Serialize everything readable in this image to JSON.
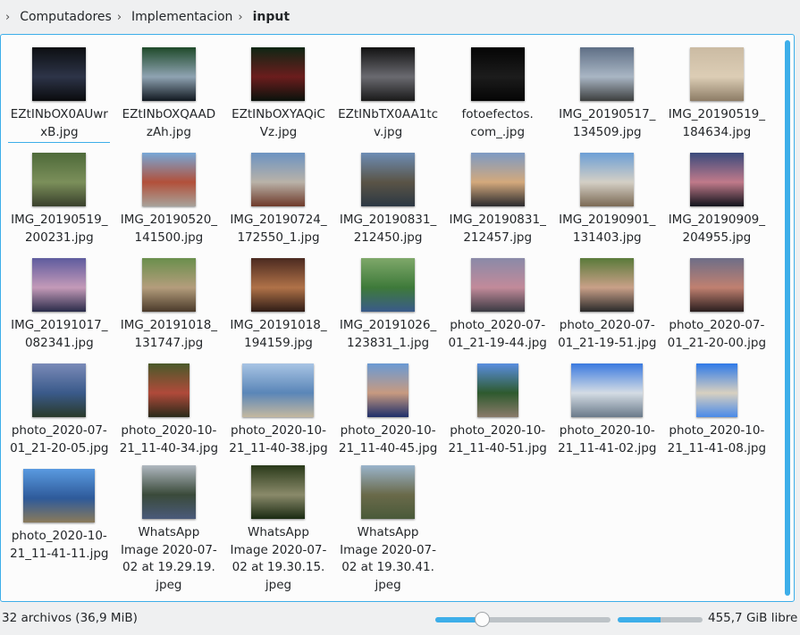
{
  "breadcrumb": {
    "items": [
      "Computadores",
      "Implementacion",
      "input"
    ]
  },
  "files": [
    {
      "name": "EZtINbOX0AUwr\nxB.jpg",
      "tw": 60,
      "th": 60,
      "colors": [
        "#0d0f12",
        "#2d3448",
        "#0a0b0d"
      ]
    },
    {
      "name": "EZtINbOXQAAD\nzAh.jpg",
      "tw": 60,
      "th": 60,
      "colors": [
        "#1f4a2a",
        "#8fa3b2",
        "#111820"
      ]
    },
    {
      "name": "EZtINbOXYAQiC\nVz.jpg",
      "tw": 60,
      "th": 60,
      "colors": [
        "#0f2614",
        "#6b1d1d",
        "#0a120c"
      ]
    },
    {
      "name": "EZtINbTX0AA1tc\nv.jpg",
      "tw": 60,
      "th": 60,
      "colors": [
        "#121212",
        "#6a6a70",
        "#1a1a1a"
      ]
    },
    {
      "name": "fotoefectos.\ncom_.jpg",
      "tw": 60,
      "th": 60,
      "colors": [
        "#050505",
        "#1c1c1c",
        "#050505"
      ]
    },
    {
      "name": "IMG_20190517_\n134509.jpg",
      "tw": 60,
      "th": 60,
      "colors": [
        "#5f6f86",
        "#a9b6c4",
        "#3d3f3f"
      ]
    },
    {
      "name": "IMG_20190519_\n184634.jpg",
      "tw": 60,
      "th": 60,
      "colors": [
        "#cbbba3",
        "#dccdb5",
        "#8d7c66"
      ]
    },
    {
      "name": "IMG_20190519_\n200231.jpg",
      "tw": 60,
      "th": 60,
      "colors": [
        "#4e6a3a",
        "#7b8f5a",
        "#39402c"
      ]
    },
    {
      "name": "IMG_20190520_\n141500.jpg",
      "tw": 60,
      "th": 60,
      "colors": [
        "#77a8d8",
        "#b2503a",
        "#a8a29a"
      ]
    },
    {
      "name": "IMG_20190724_\n172550_1.jpg",
      "tw": 60,
      "th": 60,
      "colors": [
        "#6c93c2",
        "#b9b2a8",
        "#6e3a2a"
      ]
    },
    {
      "name": "IMG_20190831_\n212450.jpg",
      "tw": 60,
      "th": 60,
      "colors": [
        "#6d8db5",
        "#5a5446",
        "#2c3844"
      ]
    },
    {
      "name": "IMG_20190831_\n212457.jpg",
      "tw": 60,
      "th": 60,
      "colors": [
        "#7d9ac4",
        "#d3a97c",
        "#2b2b2e"
      ]
    },
    {
      "name": "IMG_20190901_\n131403.jpg",
      "tw": 60,
      "th": 60,
      "colors": [
        "#6c9fd6",
        "#d4cfc5",
        "#7b6a55"
      ]
    },
    {
      "name": "IMG_20190909_\n204955.jpg",
      "tw": 60,
      "th": 60,
      "colors": [
        "#3a4a7c",
        "#c07a8a",
        "#12141c"
      ]
    },
    {
      "name": "IMG_20191017_\n082341.jpg",
      "tw": 60,
      "th": 60,
      "colors": [
        "#5e5b9e",
        "#c49ab8",
        "#2a2c4a"
      ]
    },
    {
      "name": "IMG_20191018_\n131747.jpg",
      "tw": 60,
      "th": 60,
      "colors": [
        "#6a8f4c",
        "#b49d7c",
        "#4a3a2a"
      ]
    },
    {
      "name": "IMG_20191018_\n194159.jpg",
      "tw": 60,
      "th": 60,
      "colors": [
        "#4b2a20",
        "#b07248",
        "#2f1c16"
      ]
    },
    {
      "name": "IMG_20191026_\n123831_1.jpg",
      "tw": 60,
      "th": 60,
      "colors": [
        "#7fa86a",
        "#3e7a3a",
        "#3a5a8a"
      ]
    },
    {
      "name": "photo_2020-07-\n01_21-19-44.jpg",
      "tw": 60,
      "th": 60,
      "colors": [
        "#8a8aa8",
        "#c28a9a",
        "#3a3a42"
      ]
    },
    {
      "name": "photo_2020-07-\n01_21-19-51.jpg",
      "tw": 60,
      "th": 60,
      "colors": [
        "#5a7a3a",
        "#c9a088",
        "#2a2a2a"
      ]
    },
    {
      "name": "photo_2020-07-\n01_21-20-00.jpg",
      "tw": 60,
      "th": 60,
      "colors": [
        "#6e6e88",
        "#c08070",
        "#2a1e1e"
      ]
    },
    {
      "name": "photo_2020-07-\n01_21-20-05.jpg",
      "tw": 60,
      "th": 60,
      "colors": [
        "#7a8ab8",
        "#3a5a8a",
        "#2a3a2a"
      ]
    },
    {
      "name": "photo_2020-10-\n21_11-40-34.jpg",
      "tw": 46,
      "th": 60,
      "colors": [
        "#4a5a2a",
        "#b04a3a",
        "#2a2a1a"
      ]
    },
    {
      "name": "photo_2020-10-\n21_11-40-38.jpg",
      "tw": 80,
      "th": 60,
      "colors": [
        "#a8c4e4",
        "#5a86b8",
        "#c4b8a0"
      ]
    },
    {
      "name": "photo_2020-10-\n21_11-40-45.jpg",
      "tw": 46,
      "th": 60,
      "colors": [
        "#6a9ad4",
        "#c79a80",
        "#1e2e6a"
      ]
    },
    {
      "name": "photo_2020-10-\n21_11-40-51.jpg",
      "tw": 46,
      "th": 60,
      "colors": [
        "#5a8ee0",
        "#2e5a2e",
        "#8a7a6a"
      ]
    },
    {
      "name": "photo_2020-10-\n21_11-41-02.jpg",
      "tw": 80,
      "th": 60,
      "colors": [
        "#3a7ae0",
        "#d4dce4",
        "#6a7a8a"
      ]
    },
    {
      "name": "photo_2020-10-\n21_11-41-08.jpg",
      "tw": 46,
      "th": 60,
      "colors": [
        "#2e7ae8",
        "#d8d0c0",
        "#4a8ae8"
      ]
    },
    {
      "name": "photo_2020-10-\n21_11-41-11.jpg",
      "tw": 80,
      "th": 60,
      "colors": [
        "#5a9ae0",
        "#2e5a9a",
        "#8a7a5a"
      ]
    },
    {
      "name": "WhatsApp\nImage 2020-07-\n02 at 19.29.19.\njpeg",
      "tw": 60,
      "th": 60,
      "colors": [
        "#b0b8c0",
        "#3a4a3a",
        "#4a5a7a"
      ]
    },
    {
      "name": "WhatsApp\nImage 2020-07-\n02 at 19.30.15.\njpeg",
      "tw": 60,
      "th": 60,
      "colors": [
        "#2a3a1a",
        "#8a8a6a",
        "#1a2a12"
      ]
    },
    {
      "name": "WhatsApp\nImage 2020-07-\n02 at 19.30.41.\njpeg",
      "tw": 60,
      "th": 60,
      "colors": [
        "#9ab4cc",
        "#6a6a4a",
        "#4a5a3a"
      ]
    }
  ],
  "status": {
    "summary": "32 archivos (36,9 MiB)",
    "zoom_level": 0.27,
    "space_used_fraction": 0.5,
    "free_space": "455,7 GiB libre"
  },
  "colors": {
    "accent": "#3daee9"
  }
}
